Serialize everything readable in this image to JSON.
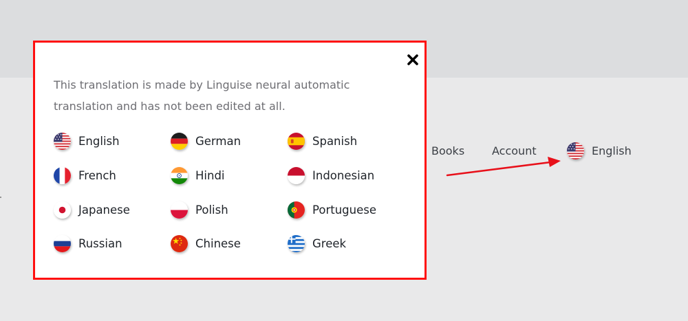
{
  "popup": {
    "notice": "This translation is made by Linguise neural automatic translation and has not been edited at all.",
    "close_icon": "close-x-icon",
    "languages": [
      {
        "label": "English",
        "flag": "us-flag-icon"
      },
      {
        "label": "German",
        "flag": "germany-flag-icon"
      },
      {
        "label": "Spanish",
        "flag": "spain-flag-icon"
      },
      {
        "label": "French",
        "flag": "france-flag-icon"
      },
      {
        "label": "Hindi",
        "flag": "india-flag-icon"
      },
      {
        "label": "Indonesian",
        "flag": "indonesia-flag-icon"
      },
      {
        "label": "Japanese",
        "flag": "japan-flag-icon"
      },
      {
        "label": "Polish",
        "flag": "poland-flag-icon"
      },
      {
        "label": "Portuguese",
        "flag": "portugal-flag-icon"
      },
      {
        "label": "Russian",
        "flag": "russia-flag-icon"
      },
      {
        "label": "Chinese",
        "flag": "china-flag-icon"
      },
      {
        "label": "Greek",
        "flag": "greece-flag-icon"
      }
    ]
  },
  "nav": {
    "books": "Books",
    "account": "Account",
    "language": "English",
    "language_flag": "us-flag-icon"
  },
  "colors": {
    "highlight_border": "#ff0f0f",
    "annotation_arrow": "#e8101a",
    "text_dark": "#1e2228",
    "text_muted": "#6e6e73"
  }
}
